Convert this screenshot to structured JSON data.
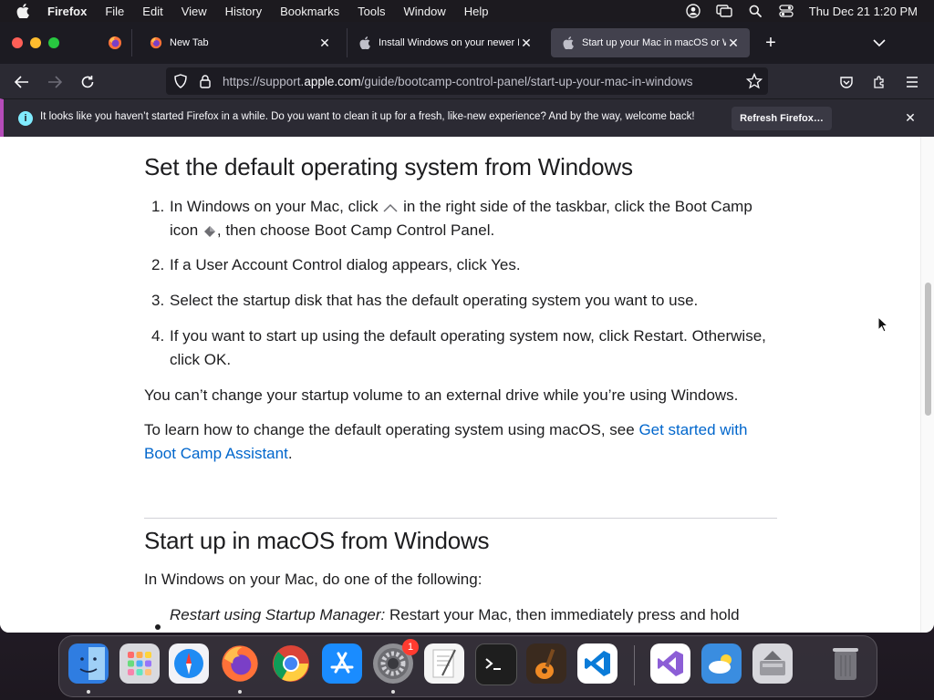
{
  "menubar": {
    "app_name": "Firefox",
    "items": [
      "File",
      "Edit",
      "View",
      "History",
      "Bookmarks",
      "Tools",
      "Window",
      "Help"
    ],
    "clock": "Thu Dec 21  1:20 PM"
  },
  "browser": {
    "tabs": [
      {
        "label": "New Tab"
      },
      {
        "label": "Install Windows on your newer Mac"
      },
      {
        "label": "Start up your Mac in macOS or Windows"
      }
    ],
    "url_prefix": "https://support.",
    "url_domain": "apple.com",
    "url_path": "/guide/bootcamp-control-panel/start-up-your-mac-in-windows",
    "notification": {
      "message": "It looks like you haven’t started Firefox in a while. Do you want to clean it up for a fresh, like-new experience? And by the way, welcome back!",
      "button": "Refresh Firefox…"
    }
  },
  "article": {
    "section1": {
      "heading": "Set the default operating system from Windows",
      "steps": [
        {
          "num": "1.",
          "a": "In Windows on your Mac, click ",
          "b": " in the right side of the taskbar, click the Boot Camp icon ",
          "c": ", then choose Boot Camp Control Panel."
        },
        {
          "num": "2.",
          "text": "If a User Account Control dialog appears, click Yes."
        },
        {
          "num": "3.",
          "text": "Select the startup disk that has the default operating system you want to use."
        },
        {
          "num": "4.",
          "text": "If you want to start up using the default operating system now, click Restart. Otherwise, click OK."
        }
      ],
      "note": "You can’t change your startup volume to an external drive while you’re using Windows.",
      "learn_prefix": "To learn how to change the default operating system using macOS, see ",
      "learn_link": "Get started with Boot Camp Assistant",
      "learn_suffix": "."
    },
    "section2": {
      "heading": "Start up in macOS from Windows",
      "intro": "In Windows on your Mac, do one of the following:",
      "bullet_italic": "Restart using Startup Manager:",
      "bullet_text": " Restart your Mac, then immediately press and hold"
    }
  },
  "dock": {
    "apps": [
      {
        "name": "Finder",
        "icon": "finder-icon",
        "color": "#2f7de1"
      },
      {
        "name": "Launchpad",
        "icon": "launchpad-icon",
        "color": "#d9d9de"
      },
      {
        "name": "Safari",
        "icon": "safari-icon",
        "color": "#1f8bf3"
      },
      {
        "name": "Firefox",
        "icon": "firefox-icon",
        "color": "#ff7139"
      },
      {
        "name": "Chrome",
        "icon": "chrome-icon",
        "color": "#ffffff"
      },
      {
        "name": "App Store",
        "icon": "app-store-icon",
        "color": "#1a8cff"
      },
      {
        "name": "System Settings",
        "icon": "system-settings-icon",
        "color": "#8e8e93"
      },
      {
        "name": "TextEdit",
        "icon": "textedit-icon",
        "color": "#f5f5f5"
      },
      {
        "name": "Terminal",
        "icon": "terminal-icon",
        "color": "#1e1e1e"
      },
      {
        "name": "GarageBand",
        "icon": "garageband-icon",
        "color": "#f08a24"
      },
      {
        "name": "Visual Studio Code",
        "icon": "vscode-icon",
        "color": "#ffffff"
      },
      {
        "name": "Visual Studio",
        "icon": "visual-studio-icon",
        "color": "#ffffff"
      },
      {
        "name": "Weather",
        "icon": "weather-icon",
        "color": "#3a8de0"
      },
      {
        "name": "Boot Camp Assistant",
        "icon": "bootcamp-icon",
        "color": "#d7d7dc"
      },
      {
        "name": "Trash",
        "icon": "trash-icon",
        "color": "#bdbdc2"
      }
    ],
    "settings_badge": "1"
  }
}
